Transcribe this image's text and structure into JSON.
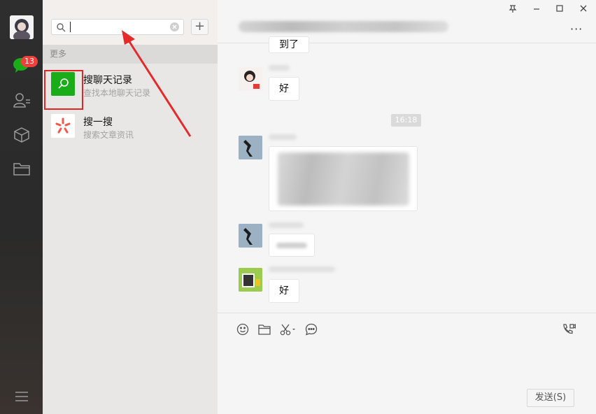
{
  "sidebar": {
    "badge_count": "13",
    "icons": [
      "chat-icon",
      "contacts-icon",
      "collections-icon",
      "folder-icon",
      "menu-icon"
    ]
  },
  "search": {
    "value": "",
    "placeholder": "",
    "add_label": "+",
    "section_title": "更多",
    "results": [
      {
        "title": "搜聊天记录",
        "subtitle": "查找本地聊天记录",
        "icon": "search-icon"
      },
      {
        "title": "搜一搜",
        "subtitle": "搜索文章资讯",
        "icon": "sou-yi-sou-icon"
      }
    ]
  },
  "window": {
    "controls": [
      "pin",
      "minimize",
      "maximize",
      "close"
    ],
    "more_label": "···"
  },
  "chat": {
    "messages": [
      {
        "text": "到了"
      },
      {
        "text": "好"
      },
      {
        "time": "16:18"
      },
      {
        "text": ""
      },
      {
        "text": ""
      },
      {
        "text": "好"
      }
    ]
  },
  "composer": {
    "tools": [
      "emoji-icon",
      "file-icon",
      "screenshot-icon",
      "chat-history-icon",
      "video-call-icon"
    ],
    "send_label": "发送(S)"
  },
  "colors": {
    "accent_green": "#1aad19",
    "badge_red": "#f1403c",
    "highlight_red": "#e32424"
  }
}
